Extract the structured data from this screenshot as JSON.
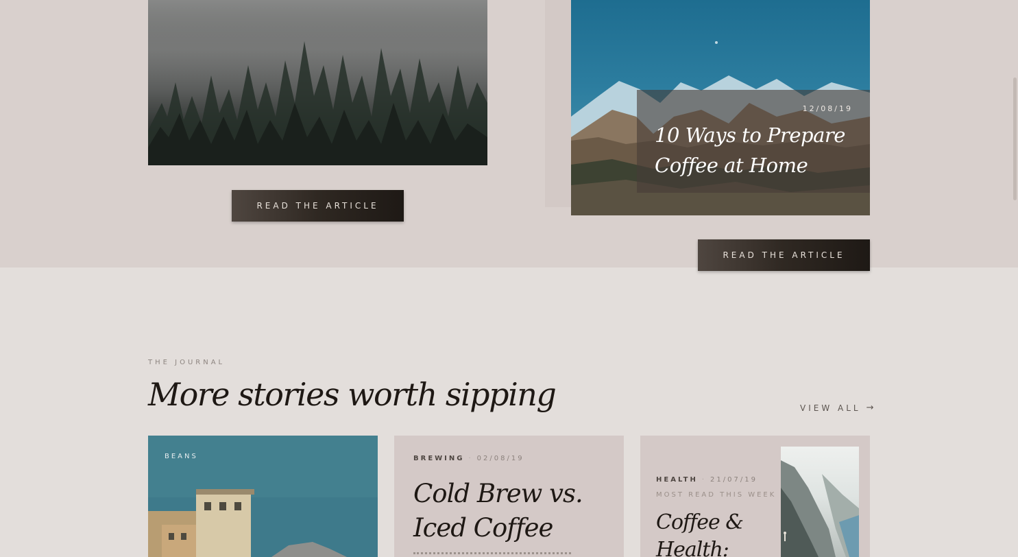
{
  "featured": {
    "forest_card": {
      "button_label": "READ THE ARTICLE"
    },
    "mountain_card": {
      "date": "12/08/19",
      "title": "10 Ways to Prepare Coffee at Home",
      "button_label": "READ THE ARTICLE"
    }
  },
  "journal": {
    "eyebrow": "THE JOURNAL",
    "title": "More stories worth sipping",
    "view_all_label": "VIEW ALL",
    "view_all_icon": "arrow-right-icon",
    "cards": [
      {
        "category": "BEANS"
      },
      {
        "category": "BREWING",
        "date": "02/08/19",
        "title": "Cold Brew vs. Iced Coffee"
      },
      {
        "category": "HEALTH",
        "date": "21/07/19",
        "badge": "MOST READ THIS WEEK",
        "title": "Coffee & Health:"
      }
    ]
  },
  "colors": {
    "page_background": "#e3dedb",
    "featured_band": "#d9d0cd",
    "card_background": "#d4c9c7",
    "button_dark": "#2f2822",
    "heading_text": "#1e1814"
  }
}
